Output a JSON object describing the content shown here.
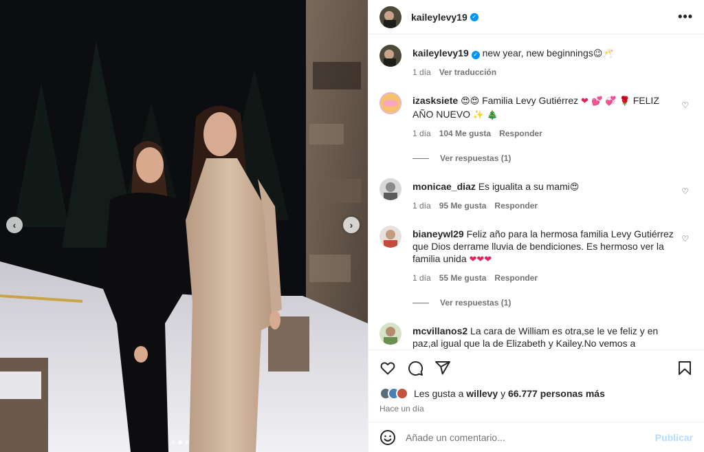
{
  "post": {
    "author": "kaileylevy19",
    "caption": "new year, new beginnings",
    "caption_emoji": "😉🥂",
    "caption_time": "1 día",
    "translate_label": "Ver traducción"
  },
  "carousel": {
    "slides": 3,
    "active": 2
  },
  "comments": [
    {
      "user": "izasksiete",
      "pre_emoji": "😍😍",
      "text": "Familia Levy Gutiérrez",
      "post_emoji": "❤ 💕 💞 🌹",
      "text2": "FELIZ AÑO NUEVO",
      "end_emoji": "✨ 🎄",
      "time": "1 día",
      "likes": "104 Me gusta",
      "reply": "Responder",
      "replies": "Ver respuestas (1)",
      "avatar_color": "#f5c26b"
    },
    {
      "user": "monicae_diaz",
      "text": "Es igualita a su mami",
      "end_emoji": "😍",
      "time": "1 día",
      "likes": "95 Me gusta",
      "reply": "Responder",
      "avatar_color": "#8a8a8a"
    },
    {
      "user": "bianeywl29",
      "text": "Feliz año para la hermosa familia Levy Gutiérrez que Dios derrame lluvia de bendiciones. Es hermoso ver la familia unida",
      "end_emoji": "❤❤❤",
      "time": "1 día",
      "likes": "55 Me gusta",
      "reply": "Responder",
      "replies": "Ver respuestas (1)",
      "avatar_color": "#c44a3c"
    },
    {
      "user": "mcvillanos2",
      "text": "La cara de William es otra,se le ve feliz y en paz,al igual que la de Elizabeth y Kailey.No vemos a Christopher pero también debe estar allá con sus padres,su hermanita y la familia de su novia y su novia.Gracias Kailey por estas lindas",
      "avatar_color": "#6b8f4e"
    }
  ],
  "likes": {
    "prefix": "Les gusta a",
    "user": "willevy",
    "connector": "y",
    "others": "66.777 personas más"
  },
  "posted_ago": "Hace un día",
  "comment_box": {
    "placeholder": "Añade un comentario...",
    "publish": "Publicar"
  },
  "colors": {
    "verified": "#0095f6",
    "publish_disabled": "#b3dbff",
    "muted": "#737373"
  }
}
